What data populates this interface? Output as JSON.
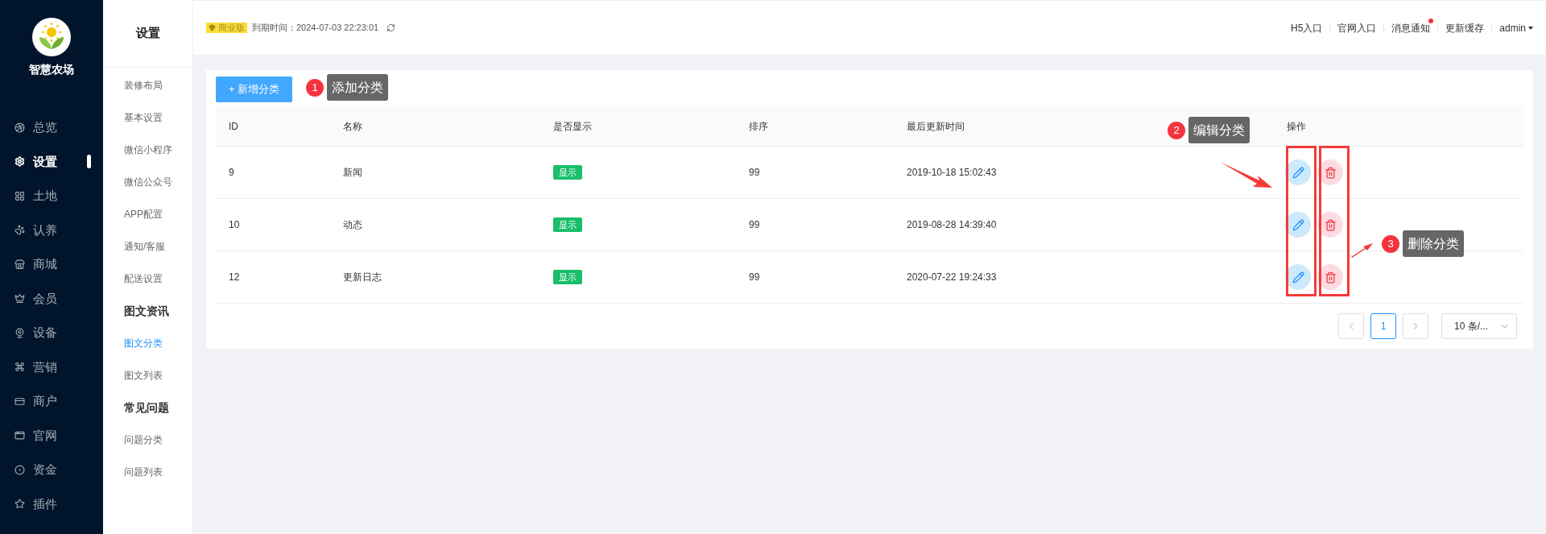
{
  "brand": {
    "name": "智慧农场"
  },
  "main_menu": [
    {
      "label": "总览",
      "selected": false
    },
    {
      "label": "设置",
      "selected": true
    },
    {
      "label": "土地",
      "selected": false
    },
    {
      "label": "认养",
      "selected": false
    },
    {
      "label": "商城",
      "selected": false
    },
    {
      "label": "会员",
      "selected": false
    },
    {
      "label": "设备",
      "selected": false
    },
    {
      "label": "营销",
      "selected": false
    },
    {
      "label": "商户",
      "selected": false
    },
    {
      "label": "官网",
      "selected": false
    },
    {
      "label": "资金",
      "selected": false
    },
    {
      "label": "插件",
      "selected": false
    }
  ],
  "sub_menu": {
    "title": "设置",
    "items": [
      {
        "kind": "item",
        "label": "装修布局",
        "selected": false
      },
      {
        "kind": "item",
        "label": "基本设置",
        "selected": false
      },
      {
        "kind": "item",
        "label": "微信小程序",
        "selected": false
      },
      {
        "kind": "item",
        "label": "微信公众号",
        "selected": false
      },
      {
        "kind": "item",
        "label": "APP配置",
        "selected": false
      },
      {
        "kind": "item",
        "label": "通知/客服",
        "selected": false
      },
      {
        "kind": "item",
        "label": "配送设置",
        "selected": false
      },
      {
        "kind": "heading",
        "label": "图文资讯"
      },
      {
        "kind": "item",
        "label": "图文分类",
        "selected": true
      },
      {
        "kind": "item",
        "label": "图文列表",
        "selected": false
      },
      {
        "kind": "heading",
        "label": "常见问题"
      },
      {
        "kind": "item",
        "label": "问题分类",
        "selected": false
      },
      {
        "kind": "item",
        "label": "问题列表",
        "selected": false
      }
    ]
  },
  "header": {
    "edition": "商业版",
    "expiry": "到期时间：2024-07-03 22:23:01",
    "links": [
      {
        "label": "H5入口",
        "dot": false
      },
      {
        "label": "官网入口",
        "dot": false
      },
      {
        "label": "消息通知",
        "dot": true
      },
      {
        "label": "更新缓存",
        "dot": false
      }
    ],
    "user": "admin"
  },
  "add_button": "+ 新增分类",
  "table": {
    "columns": [
      "ID",
      "名称",
      "是否显示",
      "排序",
      "最后更新时间",
      "操作"
    ],
    "rows": [
      {
        "id": "9",
        "name": "新闻",
        "display": "显示",
        "sort": "99",
        "updated": "2019-10-18 15:02:43"
      },
      {
        "id": "10",
        "name": "动态",
        "display": "显示",
        "sort": "99",
        "updated": "2019-08-28 14:39:40"
      },
      {
        "id": "12",
        "name": "更新日志",
        "display": "显示",
        "sort": "99",
        "updated": "2020-07-22 19:24:33"
      }
    ]
  },
  "pagination": {
    "prev_disabled": true,
    "pages": [
      {
        "label": "1",
        "selected": true
      }
    ],
    "next_disabled": true,
    "page_size": "10 条/..."
  },
  "annotations": [
    {
      "number": "1",
      "text": "添加分类"
    },
    {
      "number": "2",
      "text": "编辑分类"
    },
    {
      "number": "3",
      "text": "删除分类"
    }
  ]
}
